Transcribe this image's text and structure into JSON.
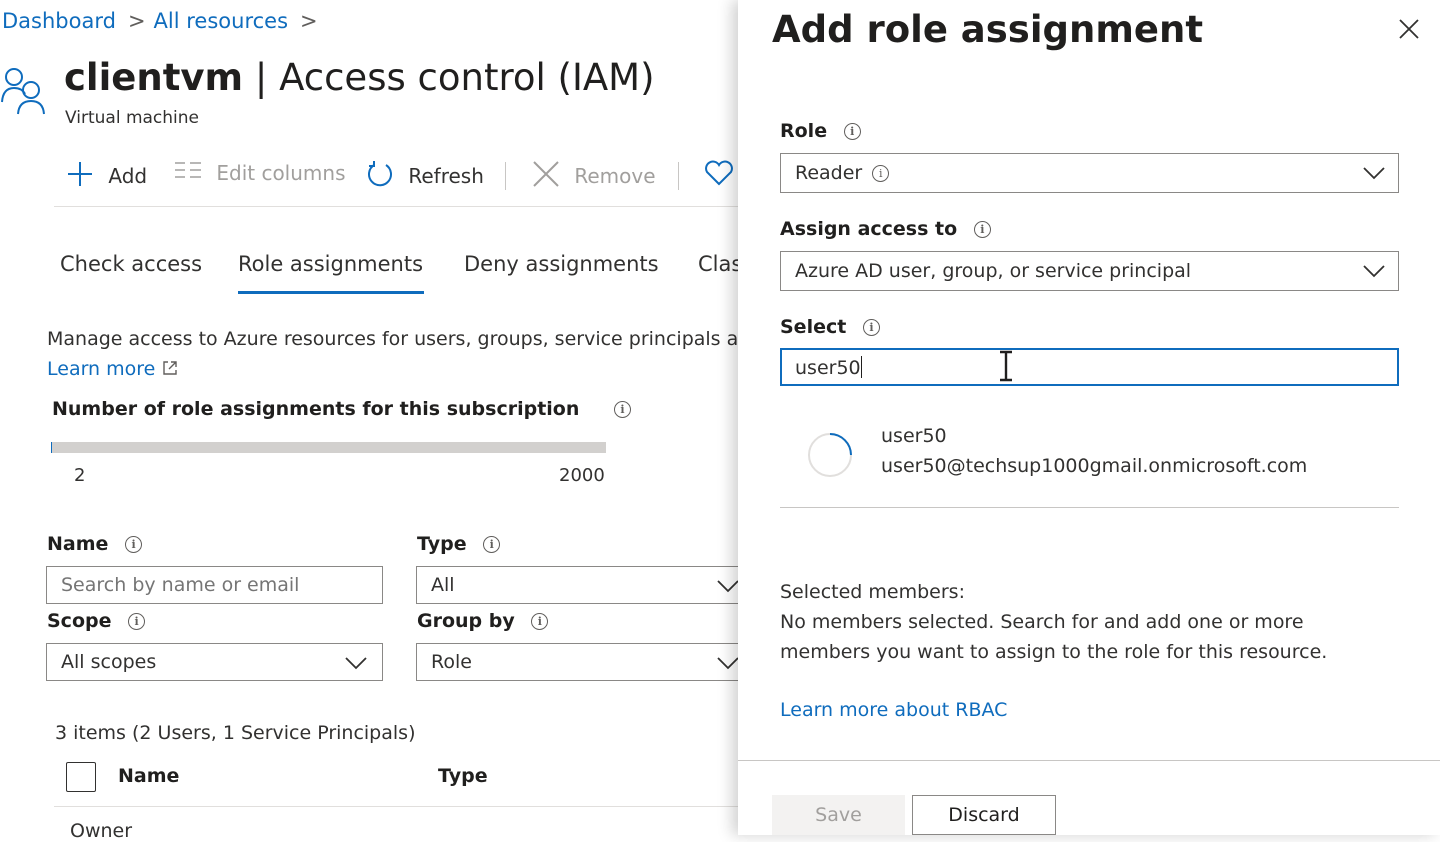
{
  "breadcrumb": {
    "items": [
      "Dashboard",
      "All resources"
    ]
  },
  "header": {
    "resource_name": "clientvm",
    "title_suffix": "| Access control (IAM)",
    "subtitle": "Virtual machine"
  },
  "toolbar": {
    "add": "Add",
    "edit_columns": "Edit columns",
    "refresh": "Refresh",
    "remove": "Remove"
  },
  "tabs": [
    "Check access",
    "Role assignments",
    "Deny assignments",
    "Clas"
  ],
  "description": {
    "text": "Manage access to Azure resources for users, groups, service principals a",
    "learn_more": "Learn more"
  },
  "assignment_count": {
    "title": "Number of role assignments for this subscription",
    "current": "2",
    "max": "2000",
    "fraction": 0.001
  },
  "filters": {
    "name_label": "Name",
    "name_placeholder": "Search by name or email",
    "type_label": "Type",
    "type_value": "All",
    "scope_label": "Scope",
    "scope_value": "All scopes",
    "group_by_label": "Group by",
    "group_by_value": "Role"
  },
  "table": {
    "summary": "3 items (2 Users, 1 Service Principals)",
    "columns": [
      "Name",
      "Type"
    ],
    "first_row_partial": "Owner"
  },
  "panel": {
    "title": "Add role assignment",
    "role_label": "Role",
    "role_value": "Reader",
    "assign_label": "Assign access to",
    "assign_value": "Azure AD user, group, or service principal",
    "select_label": "Select",
    "select_value": "user50",
    "result": {
      "name": "user50",
      "email": "user50@techsup1000gmail.onmicrosoft.com"
    },
    "selected_members_title": "Selected members:",
    "selected_members_msg_1": "No members selected. Search for and add one or more",
    "selected_members_msg_2": "members you want to assign to the role for this resource.",
    "rbac_link": "Learn more about RBAC",
    "save": "Save",
    "discard": "Discard"
  },
  "colors": {
    "accent": "#0f6cbd",
    "text": "#323130",
    "muted": "#a19f9d"
  }
}
